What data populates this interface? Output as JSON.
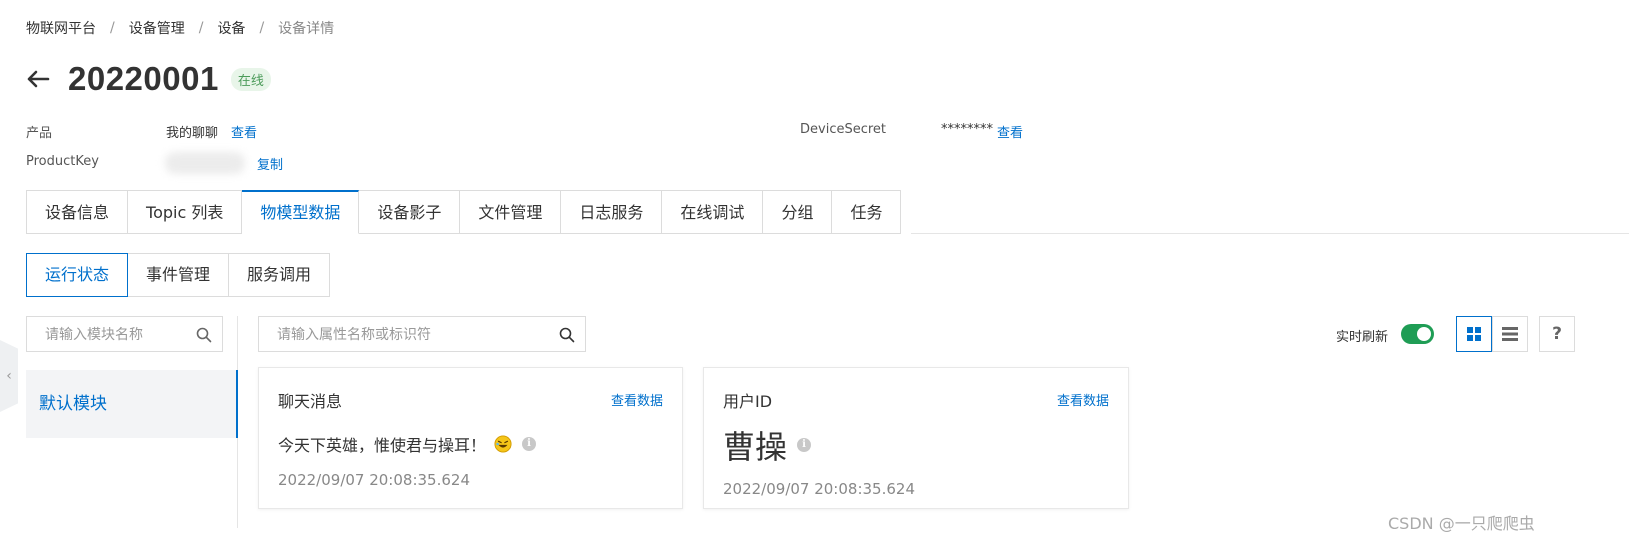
{
  "breadcrumb": {
    "items": [
      "物联网平台",
      "设备管理",
      "设备"
    ],
    "separator": "/",
    "current": "设备详情"
  },
  "device": {
    "name": "20220001",
    "status": "在线"
  },
  "meta": {
    "product_label": "产品",
    "product_value": "我的聊聊",
    "product_link": "查看",
    "productkey_label": "ProductKey",
    "productkey_link": "复制",
    "secret_label": "DeviceSecret",
    "secret_value": "********",
    "secret_link": "查看"
  },
  "tabs": [
    "设备信息",
    "Topic 列表",
    "物模型数据",
    "设备影子",
    "文件管理",
    "日志服务",
    "在线调试",
    "分组",
    "任务"
  ],
  "active_tab": "物模型数据",
  "subtabs": [
    "运行状态",
    "事件管理",
    "服务调用"
  ],
  "module_search": {
    "placeholder": "请输入模块名称"
  },
  "property_search": {
    "placeholder": "请输入属性名称或标识符"
  },
  "modules": [
    "默认模块"
  ],
  "realtime": {
    "label": "实时刷新",
    "enabled": true
  },
  "help_label": "?",
  "cards": [
    {
      "title": "聊天消息",
      "link": "查看数据",
      "value": "今天下英雄，惟使君与操耳！",
      "icon": "laughing-emoji-icon",
      "time": "2022/09/07 20:08:35.624"
    },
    {
      "title": "用户ID",
      "link": "查看数据",
      "value": "曹操",
      "time": "2022/09/07 20:08:35.624"
    }
  ],
  "watermark": "CSDN @一只爬爬虫",
  "colors": {
    "accent": "#0070cc",
    "toggle_on": "#1f9d55",
    "status_bg": "#e8f5e9",
    "status_text": "#4c9b5a"
  }
}
